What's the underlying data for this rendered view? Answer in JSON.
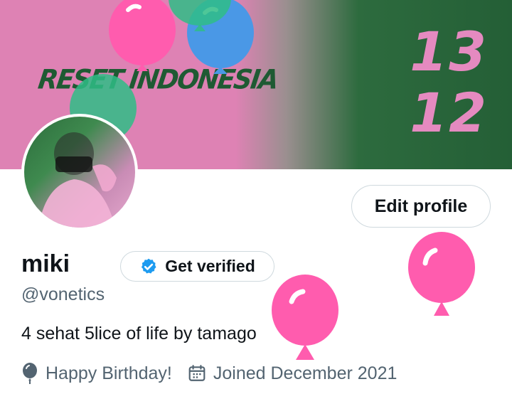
{
  "banner": {
    "text": "RESET INDONESIA",
    "date_line1": "13",
    "date_line2": "12"
  },
  "profile": {
    "name": "miki",
    "verify_label": "Get verified",
    "handle": "@vonetics",
    "bio": "4 sehat 5lice of life by tamago",
    "edit_label": "Edit profile"
  },
  "meta": {
    "birthday": "Happy Birthday!",
    "joined": "Joined December 2021"
  },
  "colors": {
    "balloon_pink": "#ff5cae",
    "balloon_blue": "#4a98e6",
    "balloon_green": "#2fbd86",
    "verified_blue": "#1d9bf0"
  },
  "icons": {
    "verified": "verified-badge-icon",
    "balloon": "balloon-icon",
    "calendar": "calendar-icon"
  }
}
